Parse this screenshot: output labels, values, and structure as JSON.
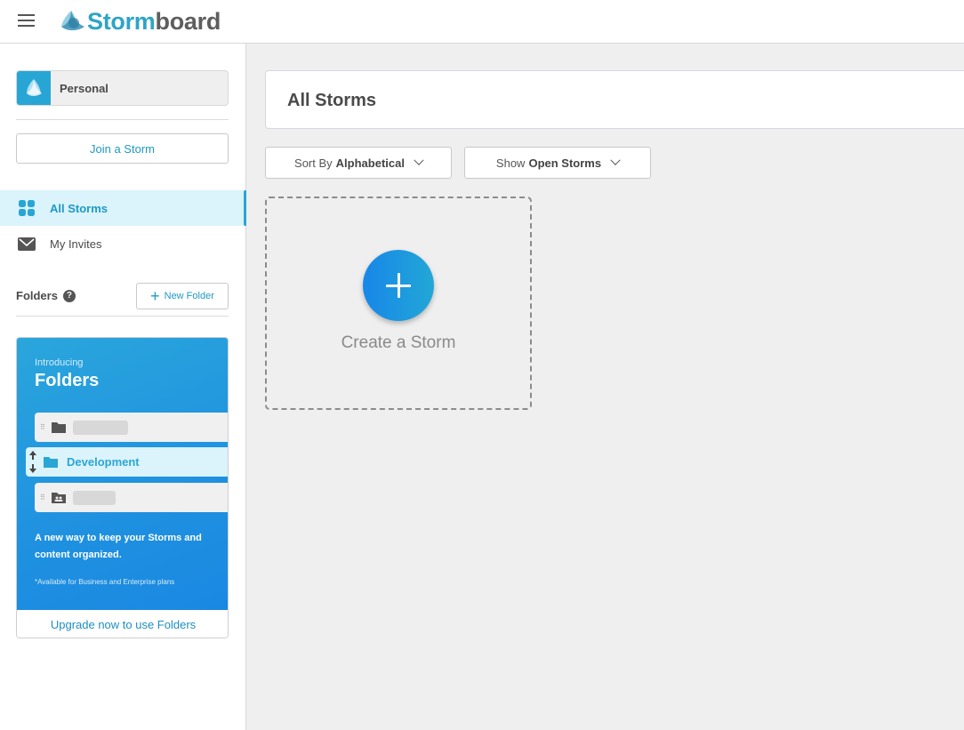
{
  "app": {
    "brand_part1": "Storm",
    "brand_part2": "board",
    "accent_color": "#27a6d6"
  },
  "sidebar": {
    "workspace": {
      "label": "Personal"
    },
    "join_button": "Join a Storm",
    "nav": [
      {
        "label": "All Storms",
        "icon": "grid-icon",
        "active": true
      },
      {
        "label": "My Invites",
        "icon": "envelope-icon",
        "active": false
      }
    ],
    "folders": {
      "label": "Folders",
      "help": "?",
      "new_folder_button": "New Folder"
    },
    "promo": {
      "intro": "Introducing",
      "title": "Folders",
      "example_folder": "Development",
      "description": "A new way to keep your Storms and content organized.",
      "note": "*Available for Business and Enterprise plans",
      "upgrade_link": "Upgrade now to use Folders"
    }
  },
  "main": {
    "title": "All Storms",
    "sort": {
      "prefix": "Sort By",
      "value": "Alphabetical"
    },
    "filter": {
      "prefix": "Show",
      "value": "Open Storms"
    },
    "create_card": {
      "label": "Create a Storm"
    }
  }
}
